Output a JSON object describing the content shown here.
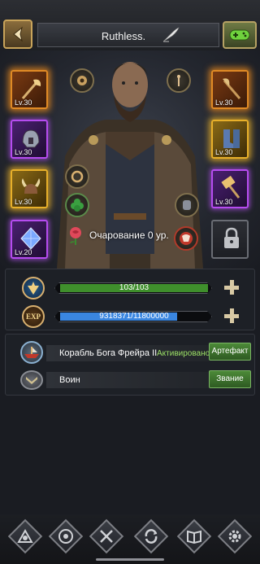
{
  "header": {
    "title": "Ruthless.",
    "back_icon": "back-arrow-icon",
    "edit_icon": "quill-icon",
    "games_icon": "gamepad-icon"
  },
  "equipment": {
    "left": [
      {
        "level": "Lv.30",
        "icon": "axe-icon",
        "rarity": "orange"
      },
      {
        "level": "Lv.30",
        "icon": "helmet-icon",
        "rarity": "purple"
      },
      {
        "level": "Lv.30",
        "icon": "horned-helmet-icon",
        "rarity": "gold"
      },
      {
        "level": "Lv.20",
        "icon": "crystal-icon",
        "rarity": "purple"
      }
    ],
    "right": [
      {
        "level": "Lv.30",
        "icon": "battle-axe-icon",
        "rarity": "orange"
      },
      {
        "level": "Lv.30",
        "icon": "boots-icon",
        "rarity": "gold"
      },
      {
        "level": "Lv.30",
        "icon": "war-hammer-icon",
        "rarity": "purple"
      },
      {
        "level": "",
        "icon": "lock-icon",
        "rarity": "locked"
      }
    ]
  },
  "charm": {
    "text": "Очарование 0 ур.",
    "icon": "rose-icon"
  },
  "stats": {
    "hp": {
      "text": "103/103",
      "fill": 1.0,
      "color": "#3f8f2c"
    },
    "exp": {
      "text": "9318371/11800000",
      "fill": 0.7897,
      "color": "#3a86e0",
      "icon_label": "EXP"
    }
  },
  "info": {
    "ship": {
      "name": "Корабль Бога Фрейра II",
      "status": "Активировано",
      "button": "Артефакт"
    },
    "rank": {
      "name": "Воин",
      "button": "Звание"
    }
  },
  "nav": [
    "hero-crest-icon",
    "wreath-emblem-icon",
    "crossed-swords-icon",
    "cycle-arrows-icon",
    "book-icon",
    "gear-icon"
  ]
}
